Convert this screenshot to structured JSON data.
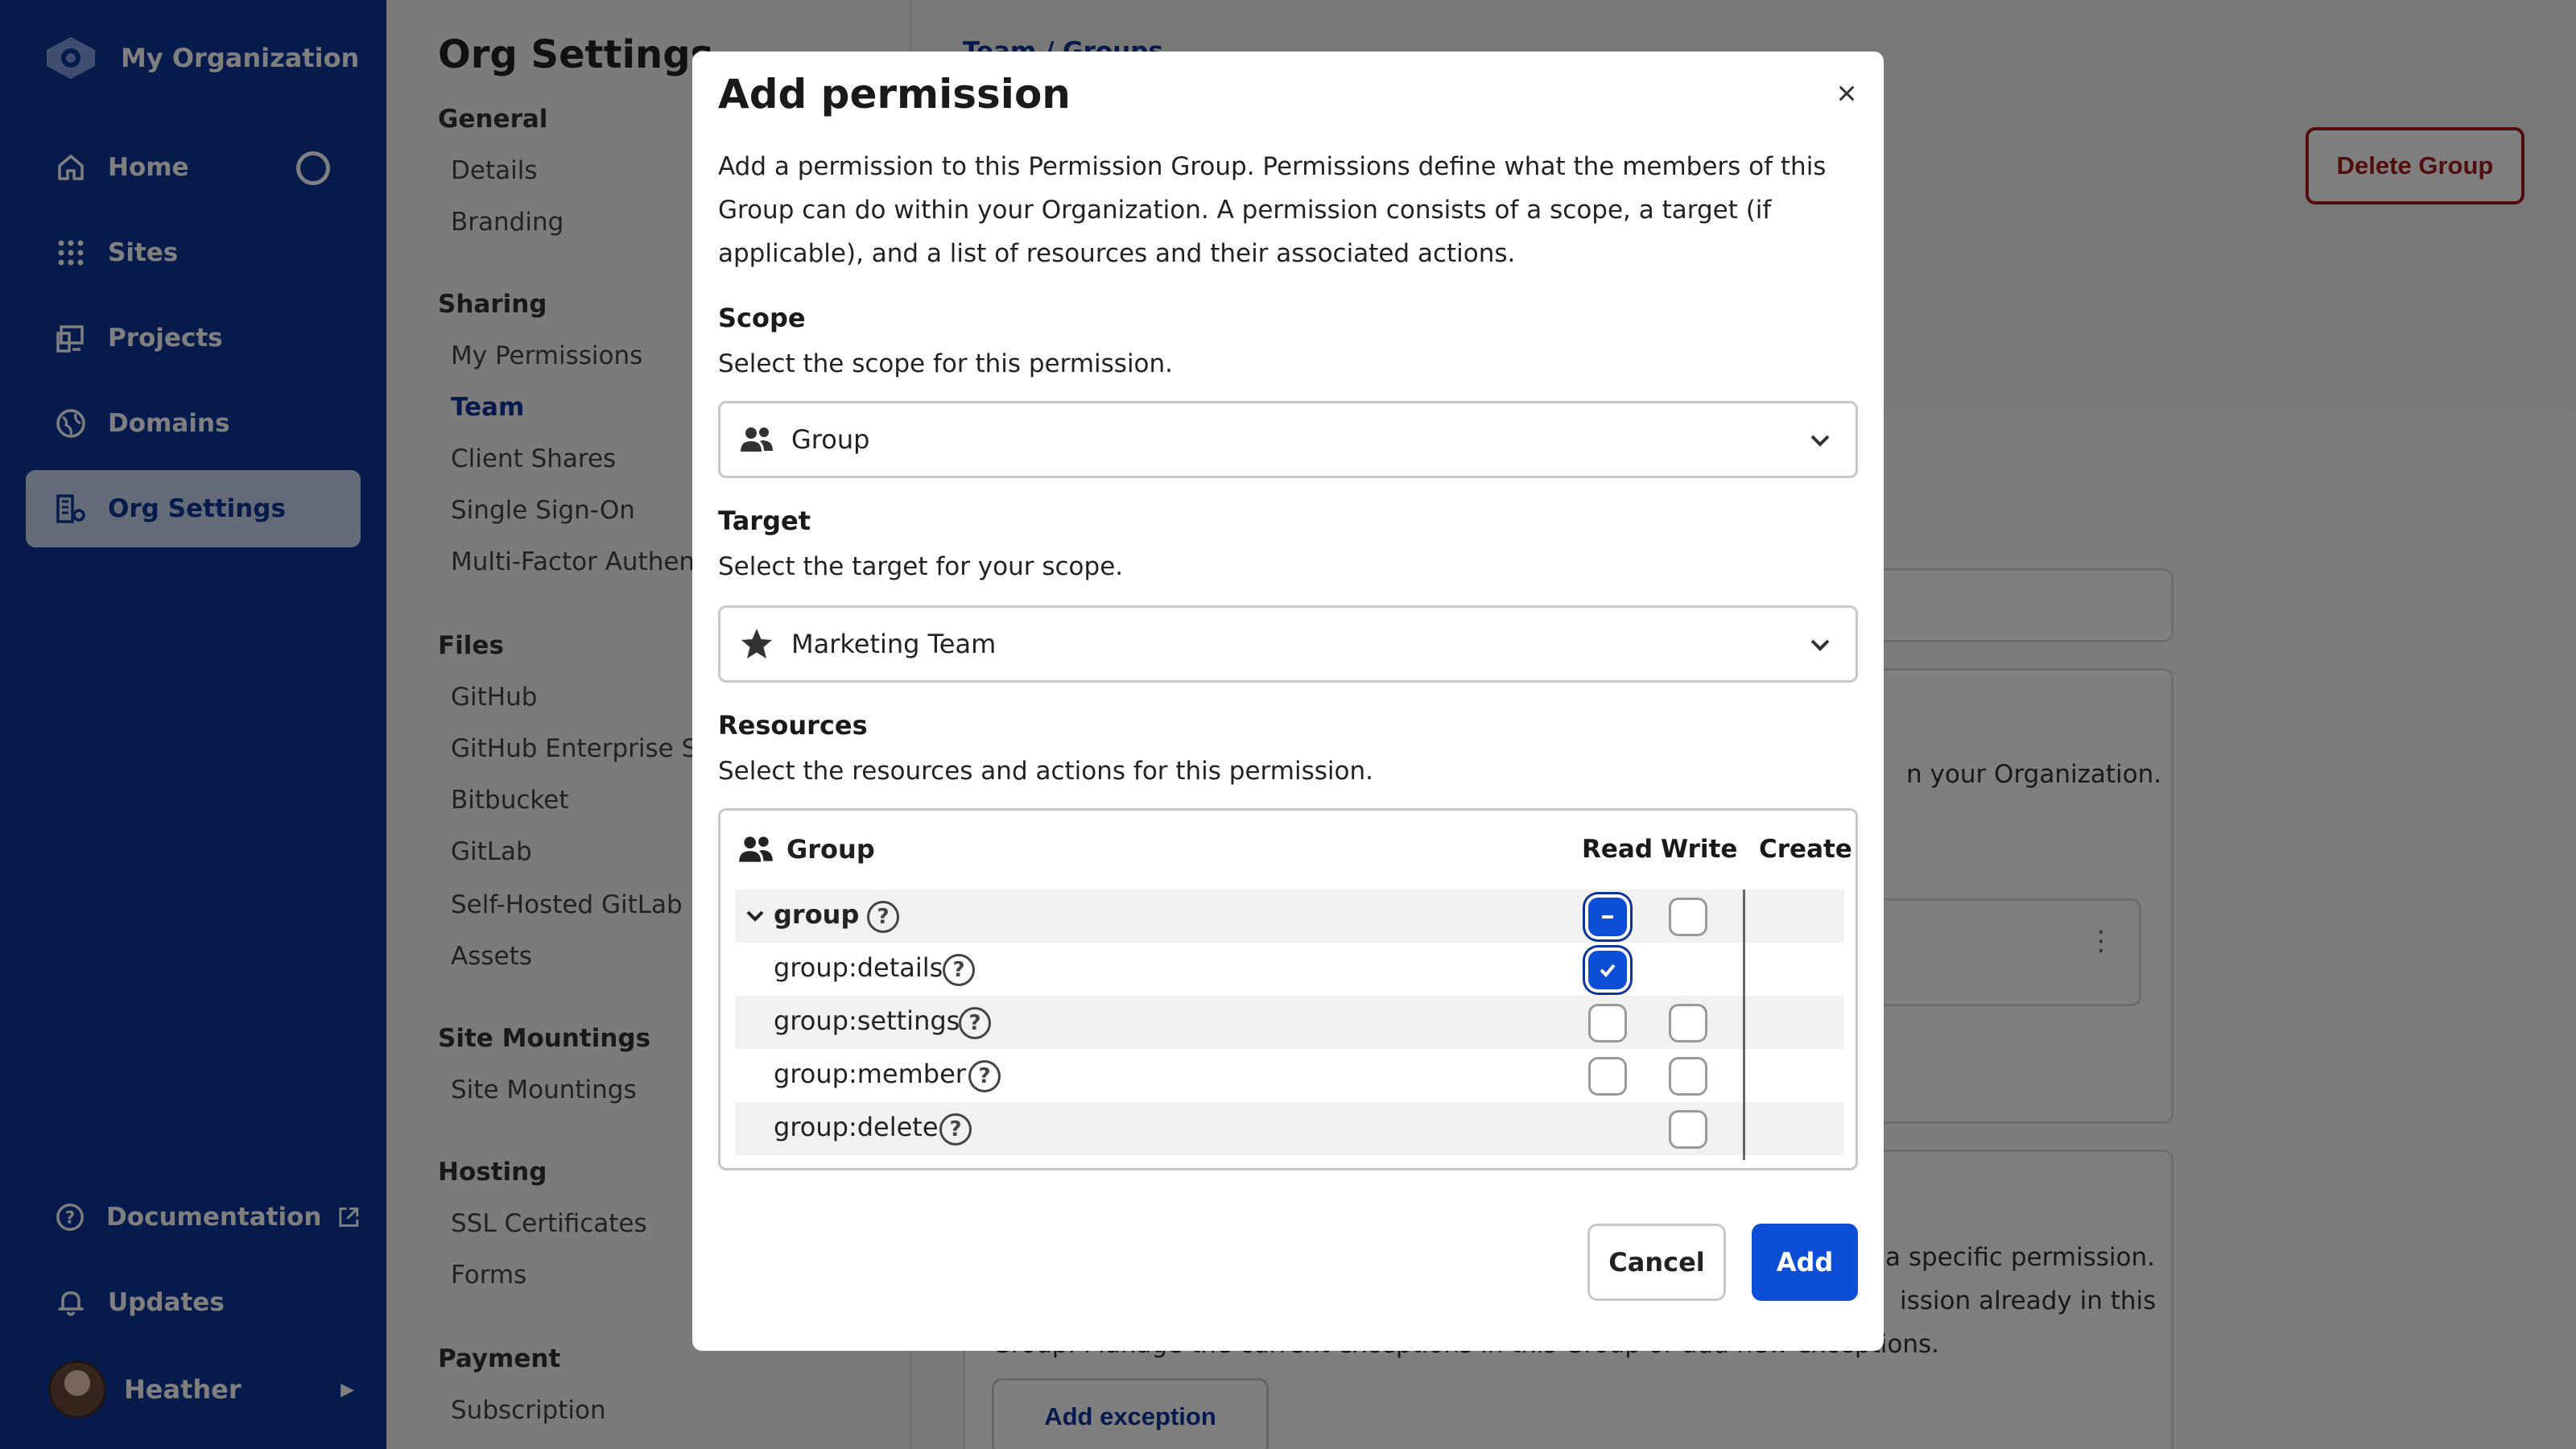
{
  "sidebar": {
    "org_name": "My Organization",
    "items": [
      {
        "label": "Home"
      },
      {
        "label": "Sites"
      },
      {
        "label": "Projects"
      },
      {
        "label": "Domains"
      },
      {
        "label": "Org Settings"
      }
    ],
    "documentation": "Documentation",
    "updates": "Updates",
    "user_name": "Heather",
    "accent_color": "#0c3499"
  },
  "settings_nav": {
    "title": "Org Settings",
    "sections": [
      {
        "heading": "General",
        "items": [
          "Details",
          "Branding"
        ]
      },
      {
        "heading": "Sharing",
        "items": [
          "My Permissions",
          "Team",
          "Client Shares",
          "Single Sign-On",
          "Multi-Factor Authent"
        ]
      },
      {
        "heading": "Files",
        "items": [
          "GitHub",
          "GitHub Enterprise Se",
          "Bitbucket",
          "GitLab",
          "Self-Hosted GitLab",
          "Assets"
        ]
      },
      {
        "heading": "Site Mountings",
        "items": [
          "Site Mountings"
        ]
      },
      {
        "heading": "Hosting",
        "items": [
          "SSL Certificates",
          "Forms"
        ]
      },
      {
        "heading": "Payment",
        "items": [
          "Subscription"
        ]
      }
    ],
    "active_item": "Team"
  },
  "main": {
    "breadcrumb": "Team / Groups",
    "delete_group": "Delete Group",
    "bg_text_1": "n your Organization.",
    "bg_text_2": "a specific permission.",
    "bg_text_3": "ission already in this",
    "bg_text_4": "Group. Manage the current exceptions in this Group or add new exceptions.",
    "add_exception": "Add exception"
  },
  "modal": {
    "title": "Add permission",
    "close": "×",
    "description": "Add a permission to this Permission Group. Permissions define what the members of this Group can do within your Organization. A permission consists of a scope, a target (if applicable), and a list of resources and their associated actions.",
    "scope_label": "Scope",
    "scope_hint": "Select the scope for this permission.",
    "scope_value": "Group",
    "target_label": "Target",
    "target_hint": "Select the target for your scope.",
    "target_value": "Marketing Team",
    "resources_label": "Resources",
    "resources_hint": "Select the resources and actions for this permission.",
    "table": {
      "group_header": "Group",
      "col_read": "Read",
      "col_write": "Write",
      "col_create": "Create",
      "rows": [
        {
          "label": "group",
          "read": "indeterminate",
          "write": "unchecked"
        },
        {
          "label": "group:details",
          "read": "checked",
          "write": "none"
        },
        {
          "label": "group:settings",
          "read": "unchecked",
          "write": "unchecked"
        },
        {
          "label": "group:member",
          "read": "unchecked",
          "write": "unchecked"
        },
        {
          "label": "group:delete",
          "read": "none",
          "write": "unchecked"
        }
      ]
    },
    "cancel": "Cancel",
    "add": "Add",
    "primary_color": "#0c4fd6"
  }
}
